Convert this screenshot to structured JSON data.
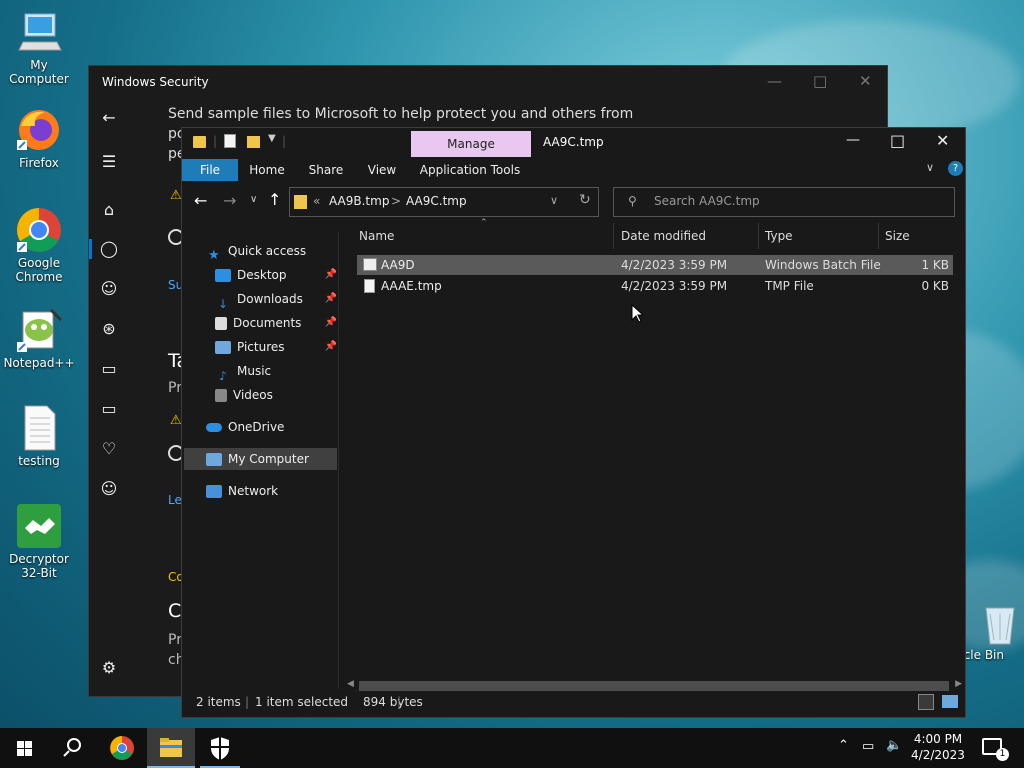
{
  "desktop": {
    "icons": [
      {
        "label": "My Computer",
        "icon": "computer-icon"
      },
      {
        "label": "Firefox",
        "icon": "firefox-icon"
      },
      {
        "label": "Google Chrome",
        "icon": "chrome-icon"
      },
      {
        "label": "Notepad++",
        "icon": "notepadpp-icon"
      },
      {
        "label": "testing",
        "icon": "text-file-icon"
      },
      {
        "label": "Decryptor 32-Bit",
        "icon": "decryptor-icon"
      },
      {
        "label": "ycle Bin",
        "icon": "recycle-bin-icon"
      }
    ]
  },
  "security": {
    "title": "Windows Security",
    "line1": "Send sample files to Microsoft to help protect you and others from",
    "line2": "po",
    "line3": "pe",
    "link1": "Su",
    "head2": "Ta",
    "sub2": "Pr",
    "link2": "Le",
    "sect": "Co",
    "head3": "Co",
    "sub3a": "Pr",
    "sub3b": "ch"
  },
  "explorer": {
    "title": "AA9C.tmp",
    "manage": "Manage",
    "tabs": [
      "File",
      "Home",
      "Share",
      "View",
      "Application Tools"
    ],
    "breadcrumb": {
      "prefix": "«",
      "parent": "AA9B.tmp",
      "sep": ">",
      "current": "AA9C.tmp"
    },
    "search_placeholder": "Search AA9C.tmp",
    "nav": {
      "quick": "Quick access",
      "items": [
        "Desktop",
        "Downloads",
        "Documents",
        "Pictures",
        "Music",
        "Videos"
      ],
      "onedrive": "OneDrive",
      "mycomputer": "My Computer",
      "network": "Network"
    },
    "columns": [
      "Name",
      "Date modified",
      "Type",
      "Size"
    ],
    "files": [
      {
        "name": "AA9D",
        "date": "4/2/2023 3:59 PM",
        "type": "Windows Batch File",
        "size": "1 KB",
        "selected": true
      },
      {
        "name": "AAAE.tmp",
        "date": "4/2/2023 3:59 PM",
        "type": "TMP File",
        "size": "0 KB",
        "selected": false
      }
    ],
    "status": {
      "items": "2 items",
      "selected": "1 item selected",
      "bytes": "894 bytes"
    }
  },
  "taskbar": {
    "time": "4:00 PM",
    "date": "4/2/2023",
    "notif_count": "1"
  },
  "colors": {
    "manage_tab": "#e8c8f0",
    "file_tab": "#1e7db8",
    "selection": "#5a5a5a",
    "accent": "#0078d4"
  }
}
